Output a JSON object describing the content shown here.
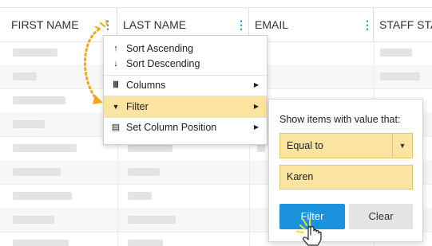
{
  "columns": [
    {
      "label": "FIRST NAME"
    },
    {
      "label": "LAST NAME"
    },
    {
      "label": "EMAIL"
    },
    {
      "label": "STAFF STA"
    }
  ],
  "context_menu": {
    "items": [
      {
        "icon": "arrow-up-icon",
        "glyph": "↑",
        "label": "Sort Ascending"
      },
      {
        "icon": "arrow-down-icon",
        "glyph": "↓",
        "label": "Sort Descending"
      },
      {
        "icon": "columns-icon",
        "glyph": "Ⅲ",
        "label": "Columns"
      },
      {
        "icon": "filter-icon",
        "glyph": "▼",
        "label": "Filter"
      },
      {
        "icon": "column-position-icon",
        "glyph": "▤",
        "label": "Set Column Position"
      }
    ]
  },
  "filter_panel": {
    "title": "Show items with value that:",
    "operator": "Equal to",
    "value": "Karen",
    "filter_label": "Filter",
    "clear_label": "Clear"
  },
  "colors": {
    "accent": "#1d92dc",
    "highlight": "#fbe3a0",
    "annotation": "#f0a81c"
  }
}
